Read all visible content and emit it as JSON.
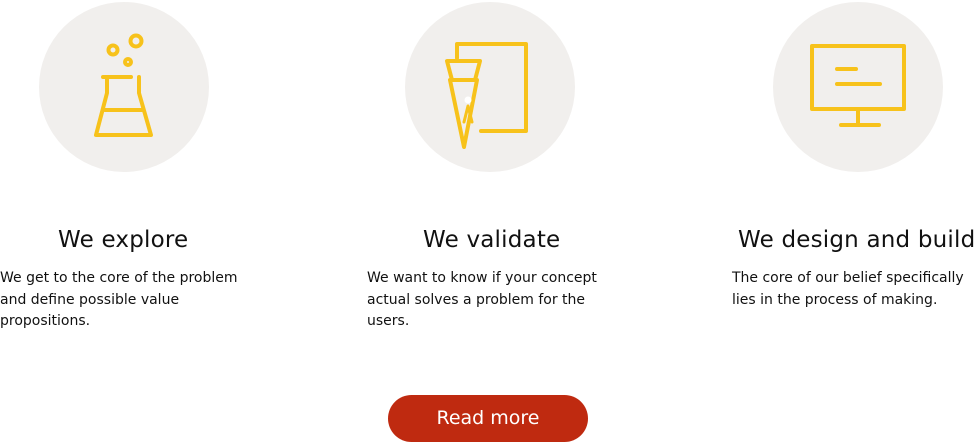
{
  "accent_color": "#f7c21b",
  "circle_color": "#f1efed",
  "button_color": "#bf2a10",
  "features": [
    {
      "icon": "flask-icon",
      "title": "We explore",
      "description": "We get to the core of the problem and define possible value propositions."
    },
    {
      "icon": "coffee-filter-icon",
      "title": "We validate",
      "description": "We want to know if your concept actual solves a problem for the users."
    },
    {
      "icon": "monitor-icon",
      "title": "We design and build",
      "description": "The core of our belief specifically lies in the process of making."
    }
  ],
  "cta": {
    "label": "Read more"
  }
}
